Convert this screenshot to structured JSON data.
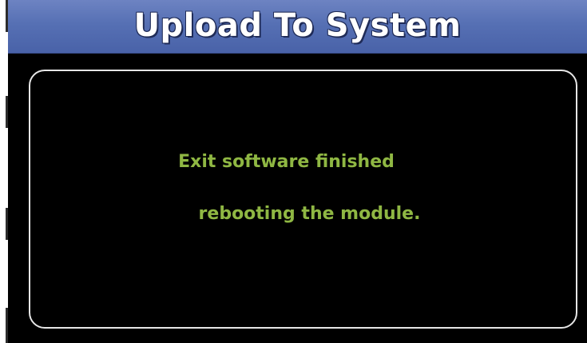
{
  "dialog": {
    "title": "Upload To System",
    "message_lines": [
      "Exit software finished",
      "rebooting the module."
    ]
  },
  "colors": {
    "title_bar": "#5670b4",
    "title_text": "#ffffff",
    "background": "#000000",
    "panel_border": "#e6e6e6",
    "message_text": "#8fb743"
  }
}
